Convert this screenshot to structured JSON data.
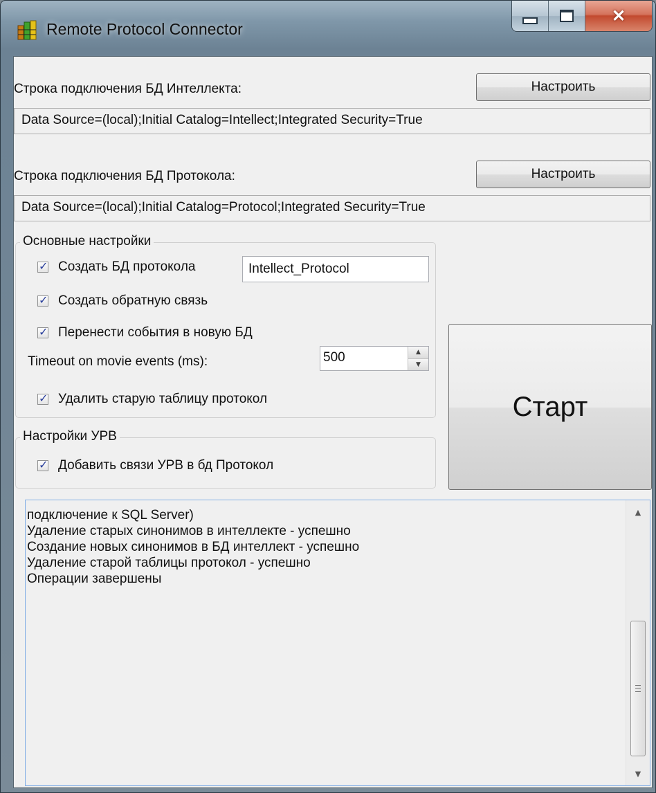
{
  "window": {
    "title": "Remote Protocol Connector"
  },
  "intellect_db": {
    "label": "Строка подключения БД Интеллекта:",
    "configure_label": "Настроить",
    "connection_string": "Data Source=(local);Initial Catalog=Intellect;Integrated Security=True"
  },
  "protocol_db": {
    "label": "Строка подключения БД Протокола:",
    "configure_label": "Настроить",
    "connection_string": "Data Source=(local);Initial Catalog=Protocol;Integrated Security=True"
  },
  "main_settings": {
    "title": "Основные настройки",
    "create_db": {
      "label": "Создать БД протокола",
      "checked": true,
      "db_name": "Intellect_Protocol"
    },
    "create_feedback": {
      "label": "Создать обратную связь",
      "checked": true
    },
    "move_events": {
      "label": "Перенести события в новую БД",
      "checked": true
    },
    "timeout": {
      "label": "Timeout on movie events (ms):",
      "value": "500"
    },
    "delete_old_table": {
      "label": "Удалить старую таблицу протокол",
      "checked": true
    }
  },
  "urv_settings": {
    "title": "Настройки УРВ",
    "add_links": {
      "label": "Добавить связи УРВ в бд Протокол",
      "checked": true
    }
  },
  "start_button": {
    "label": "Старт"
  },
  "log": {
    "lines": [
      "подключение к SQL Server)",
      "Удаление старых синонимов в интеллекте - успешно",
      "Создание новых синонимов в БД интеллект - успешно",
      "Удаление старой таблицы протокол - успешно",
      "Операции завершены"
    ]
  },
  "colors": {
    "window_frame": "#7f97a9",
    "close_button": "#c24a2f",
    "client_bg": "#f0f0f0",
    "checkmark": "#2a3f9c"
  },
  "icons": [
    "app-icon",
    "minimize-icon",
    "maximize-icon",
    "close-icon",
    "checkmark-icon",
    "spin-up-icon",
    "spin-down-icon",
    "scroll-up-icon",
    "scroll-down-icon",
    "scroll-grip-icon"
  ]
}
